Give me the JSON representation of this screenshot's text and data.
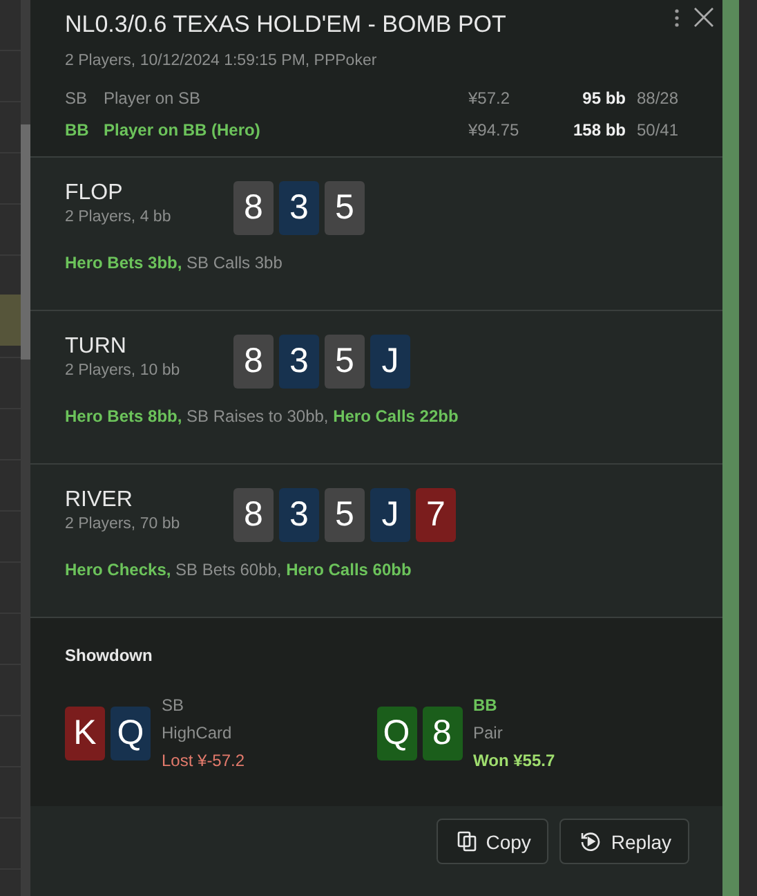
{
  "title": "NL0.3/0.6 TEXAS HOLD'EM - BOMB POT",
  "subtitle": "2 Players, 10/12/2024 1:59:15 PM, PPPoker",
  "players": [
    {
      "position": "SB",
      "name": "Player on SB",
      "hero": false,
      "amount": "¥57.2",
      "stack": "95 bb",
      "stats": "88/28"
    },
    {
      "position": "BB",
      "name": "Player on BB (Hero)",
      "hero": true,
      "amount": "¥94.75",
      "stack": "158 bb",
      "stats": "50/41"
    }
  ],
  "streets": [
    {
      "name": "FLOP",
      "info": "2 Players, 4 bb",
      "cards": [
        {
          "rank": "8",
          "color": "#454545"
        },
        {
          "rank": "3",
          "color": "#17324f"
        },
        {
          "rank": "5",
          "color": "#454545"
        }
      ],
      "actions": "**Hero Bets 3bb,** SB Calls 3bb"
    },
    {
      "name": "TURN",
      "info": "2 Players, 10 bb",
      "cards": [
        {
          "rank": "8",
          "color": "#454545"
        },
        {
          "rank": "3",
          "color": "#17324f"
        },
        {
          "rank": "5",
          "color": "#454545"
        },
        {
          "rank": "J",
          "color": "#17324f"
        }
      ],
      "actions": "**Hero Bets 8bb,** SB Raises to 30bb, **Hero Calls 22bb**"
    },
    {
      "name": "RIVER",
      "info": "2 Players, 70 bb",
      "cards": [
        {
          "rank": "8",
          "color": "#454545"
        },
        {
          "rank": "3",
          "color": "#17324f"
        },
        {
          "rank": "5",
          "color": "#454545"
        },
        {
          "rank": "J",
          "color": "#17324f"
        },
        {
          "rank": "7",
          "color": "#7b1d1d"
        }
      ],
      "actions": "**Hero Checks,** SB Bets 60bb, **Hero Calls 60bb**"
    }
  ],
  "showdown": {
    "title": "Showdown",
    "hands": [
      {
        "cards": [
          {
            "rank": "K",
            "color": "#7b1d1d"
          },
          {
            "rank": "Q",
            "color": "#17324f"
          }
        ],
        "position": "SB",
        "hero": false,
        "hand": "HighCard",
        "result": "Lost ¥-57.2",
        "kind": "lost"
      },
      {
        "cards": [
          {
            "rank": "Q",
            "color": "#1b5e1b"
          },
          {
            "rank": "8",
            "color": "#1b5e1b"
          }
        ],
        "position": "BB",
        "hero": true,
        "hand": "Pair",
        "result": "Won ¥55.7",
        "kind": "won"
      }
    ]
  },
  "buttons": [
    {
      "label": "Copy",
      "kind": "copy"
    },
    {
      "label": "Replay",
      "kind": "replay"
    }
  ]
}
